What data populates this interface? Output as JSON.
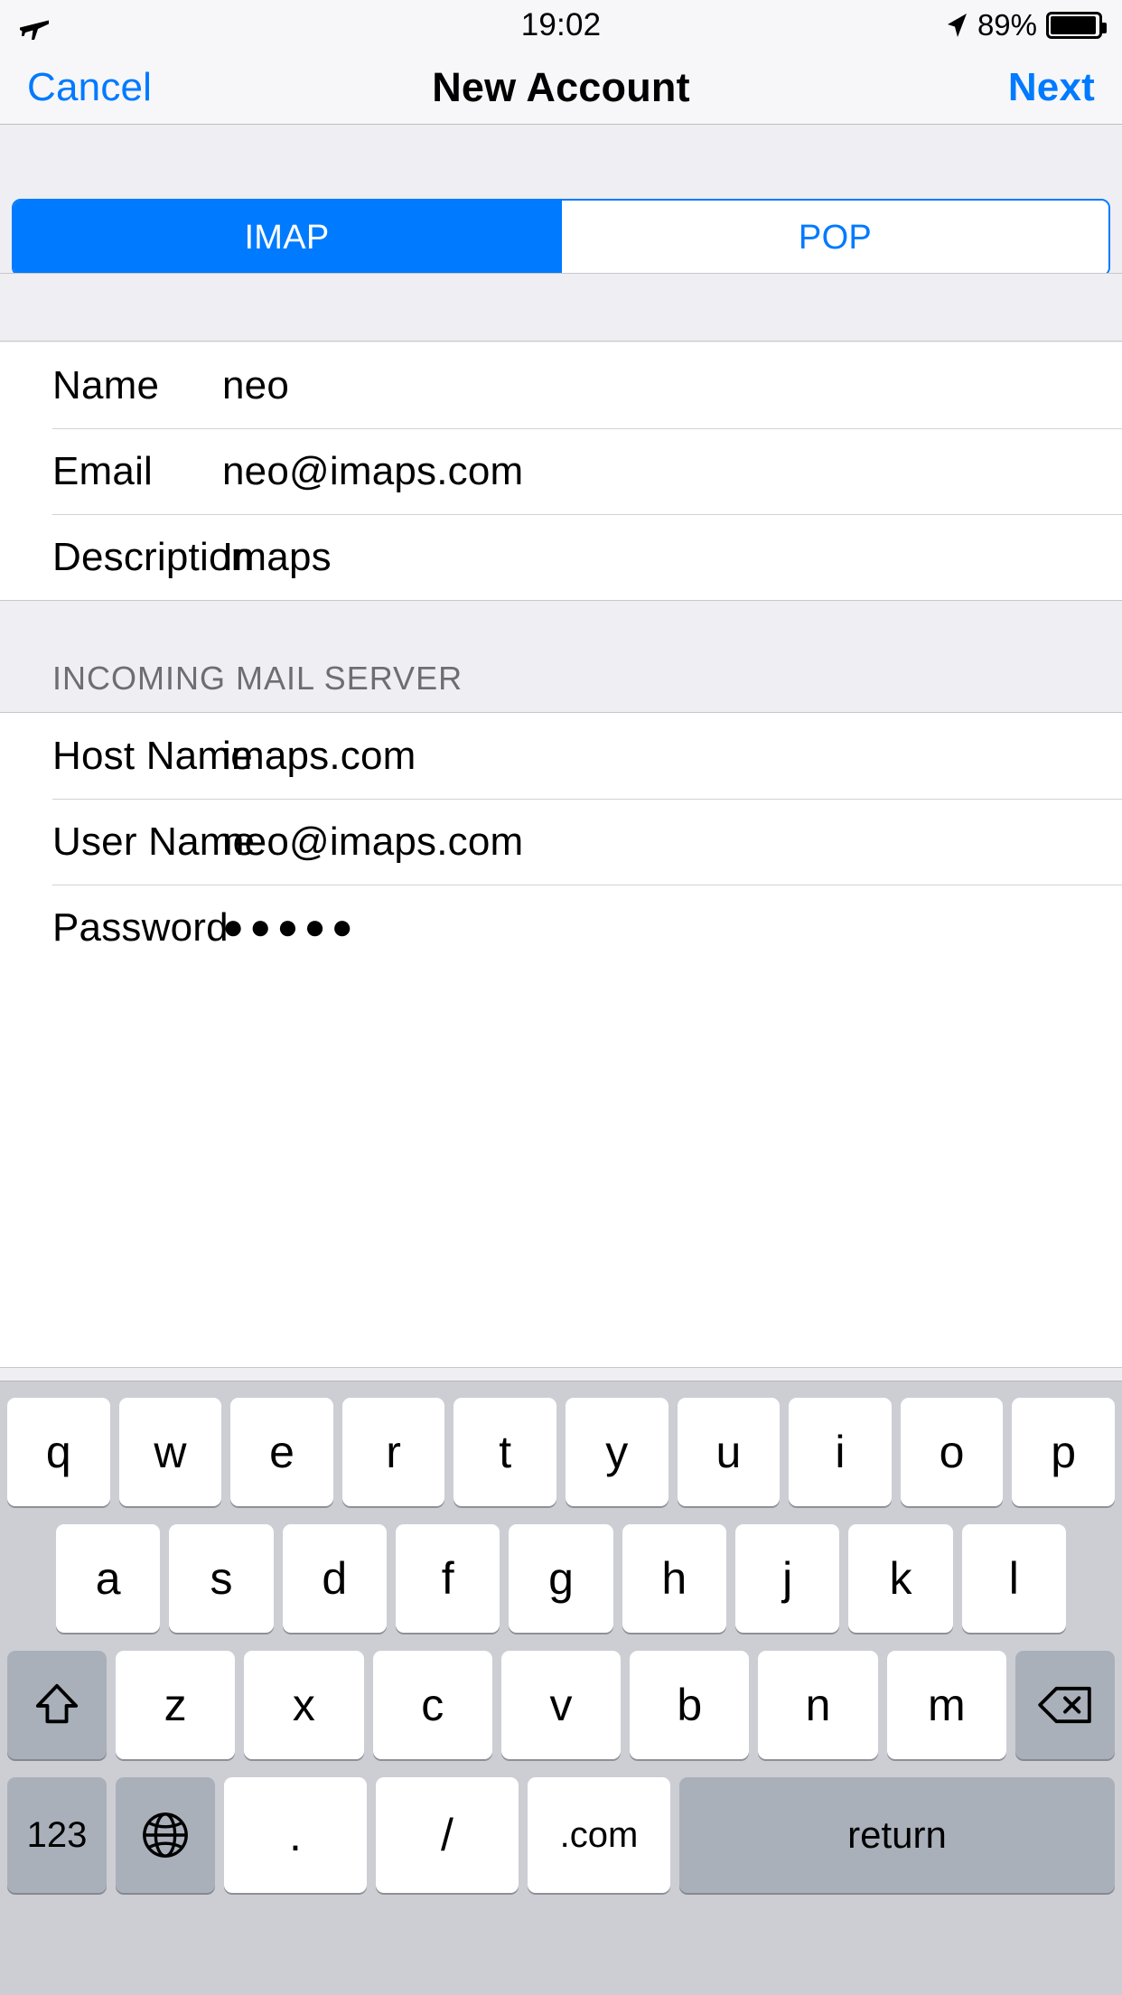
{
  "status_bar": {
    "airplane_icon": "airplane-icon",
    "time": "19:02",
    "location_icon": "location-arrow-icon",
    "battery_percent": "89%",
    "battery_icon": "battery-icon"
  },
  "nav_bar": {
    "cancel_label": "Cancel",
    "title": "New Account",
    "next_label": "Next"
  },
  "segmented_control": {
    "options": [
      "IMAP",
      "POP"
    ],
    "selected": "IMAP",
    "selected_bg": "#007aff",
    "selected_fg": "#ffffff",
    "unselected_fg": "#007aff"
  },
  "account_section": {
    "rows": [
      {
        "label": "Name",
        "value": "neo"
      },
      {
        "label": "Email",
        "value": "neo@imaps.com"
      },
      {
        "label": "Description",
        "value": "Imaps"
      }
    ]
  },
  "incoming_section": {
    "header": "INCOMING MAIL SERVER",
    "rows": [
      {
        "label": "Host Name",
        "value": "imaps.com"
      },
      {
        "label": "User Name",
        "value": "neo@imaps.com"
      },
      {
        "label": "Password",
        "value": "●●●●●"
      }
    ]
  },
  "keyboard": {
    "row1": [
      "q",
      "w",
      "e",
      "r",
      "t",
      "y",
      "u",
      "i",
      "o",
      "p"
    ],
    "row2": [
      "a",
      "s",
      "d",
      "f",
      "g",
      "h",
      "j",
      "k",
      "l"
    ],
    "row3_letters": [
      "z",
      "x",
      "c",
      "v",
      "b",
      "n",
      "m"
    ],
    "shift_icon": "shift-arrow-icon",
    "backspace_icon": "backspace-icon",
    "numbers_key": "123",
    "globe_icon": "globe-icon",
    "period_key": ".",
    "slash_key": "/",
    "dotcom_key": ".com",
    "return_key": "return"
  },
  "colors": {
    "accent": "#007aff",
    "bar_bg": "#f7f7f9",
    "group_bg": "#eeeef3",
    "keyboard_bg": "#ccced3",
    "key_dark": "#aab0ba",
    "separator": "#d3d3d6",
    "section_header_text": "#6d6d72"
  }
}
